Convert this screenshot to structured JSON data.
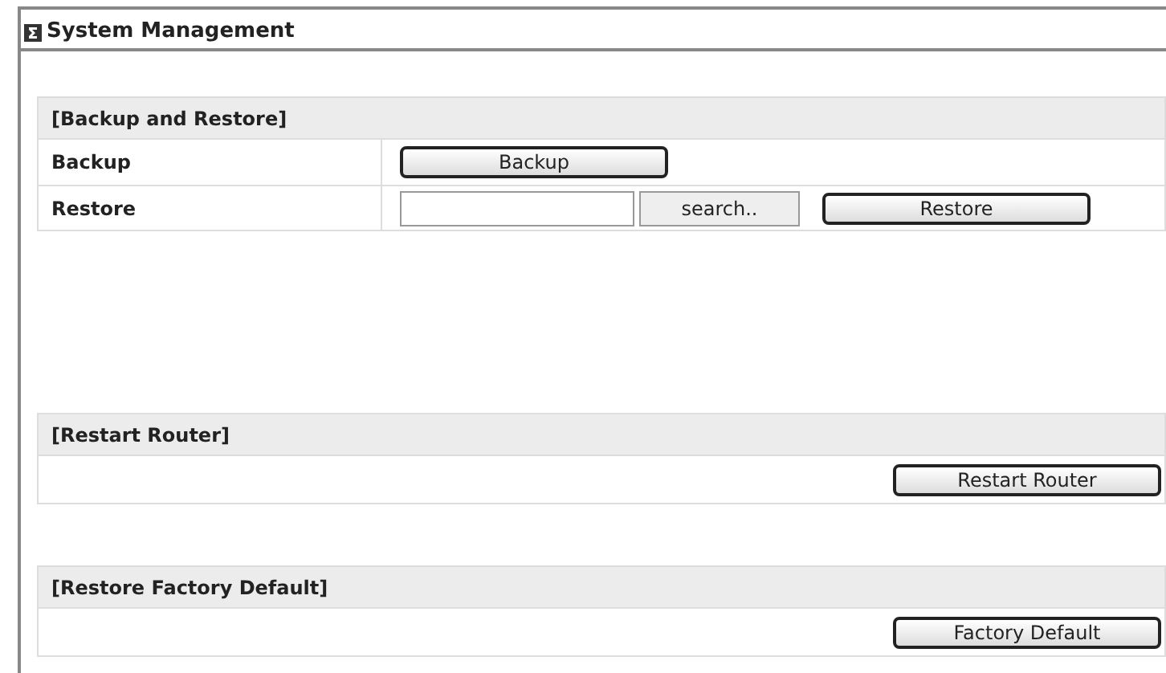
{
  "title": "System Management",
  "sections": [
    {
      "kind": "form",
      "heading": "[Backup and Restore]",
      "rows": [
        {
          "kind": "button",
          "label": "Backup",
          "button": "Backup"
        },
        {
          "kind": "file",
          "label": "Restore",
          "browse": "search..",
          "button": "Restore"
        }
      ]
    },
    {
      "kind": "action",
      "heading": "[Restart Router]",
      "button": "Restart Router"
    },
    {
      "kind": "action",
      "heading": "[Restore Factory Default]",
      "button": "Factory Default"
    }
  ]
}
